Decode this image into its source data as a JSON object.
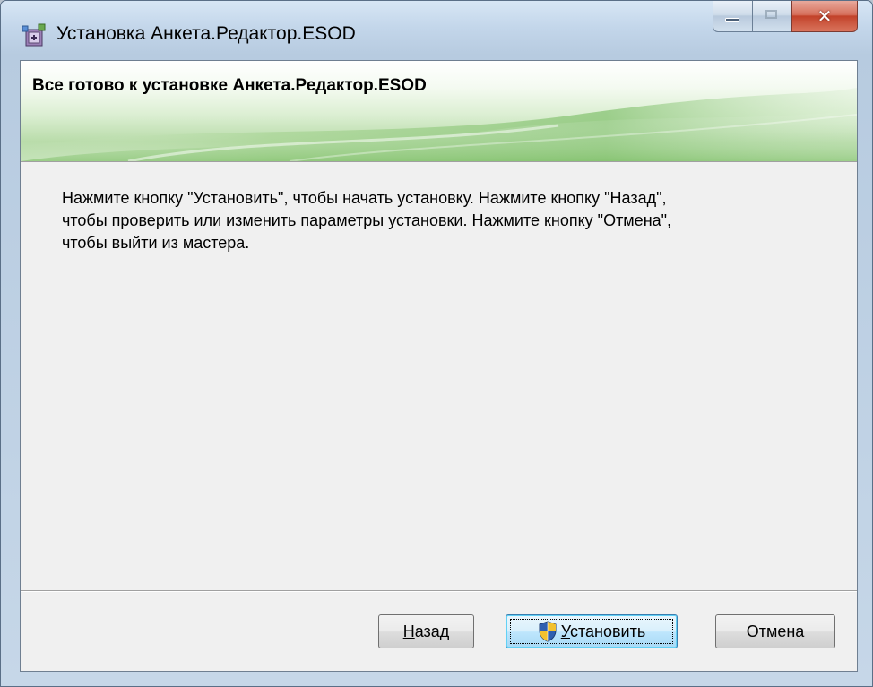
{
  "window": {
    "title": "Установка Анкета.Редактор.ESOD",
    "icon": "installer-package-icon"
  },
  "caption_buttons": {
    "minimize_icon": "minimize-icon",
    "maximize_icon": "maximize-icon",
    "close_icon": "close-icon",
    "close_glyph": "✕"
  },
  "banner": {
    "title": "Все готово к установке Анкета.Редактор.ESOD"
  },
  "body": {
    "text": "Нажмите кнопку \"Установить\", чтобы начать установку. Нажмите кнопку \"Назад\",\nчтобы проверить или изменить параметры установки. Нажмите кнопку \"Отмена\",\nчтобы выйти из мастера."
  },
  "buttons": {
    "back": {
      "accel": "Н",
      "rest": "азад"
    },
    "install": {
      "accel": "У",
      "rest": "становить",
      "icon": "uac-shield-icon"
    },
    "cancel": {
      "label": "Отмена"
    }
  },
  "colors": {
    "banner_green": "#b9dcaa",
    "window_frame": "#c3d6ea",
    "close_red": "#c2422a",
    "default_button_border": "#3c7fb1"
  }
}
